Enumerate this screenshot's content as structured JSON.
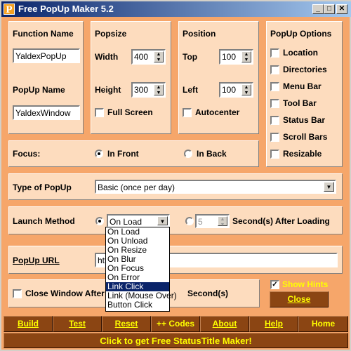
{
  "window": {
    "title": "Free PopUp Maker 5.2",
    "logo": "P",
    "minimize": "_",
    "maximize": "□",
    "close": "✕"
  },
  "function_panel": {
    "function_name_label": "Function Name",
    "function_name_value": "YaldexPopUp",
    "popup_name_label": "PopUp Name",
    "popup_name_value": "YaldexWindow"
  },
  "popsize": {
    "title": "Popsize",
    "width_label": "Width",
    "width_value": "400",
    "height_label": "Height",
    "height_value": "300",
    "full_screen_label": "Full Screen",
    "full_screen_checked": false
  },
  "position": {
    "title": "Position",
    "top_label": "Top",
    "top_value": "100",
    "left_label": "Left",
    "left_value": "100",
    "autocenter_label": "Autocenter",
    "autocenter_checked": false
  },
  "options": {
    "title": "PopUp Options",
    "items": [
      {
        "label": "Location",
        "checked": false
      },
      {
        "label": "Directories",
        "checked": false
      },
      {
        "label": "Menu Bar",
        "checked": false
      },
      {
        "label": "Tool Bar",
        "checked": false
      },
      {
        "label": "Status Bar",
        "checked": false
      },
      {
        "label": "Scroll Bars",
        "checked": false
      },
      {
        "label": "Resizable",
        "checked": false
      }
    ]
  },
  "focus": {
    "label": "Focus:",
    "in_front": "In Front",
    "in_back": "In Back",
    "selected": "In Front"
  },
  "type": {
    "label": "Type of PopUp",
    "value": "Basic (once per day)"
  },
  "launch": {
    "label": "Launch Method",
    "value": "On Load",
    "seconds_value": "5",
    "seconds_label": "Second(s) After Loading",
    "options": [
      "On Load",
      "On Unload",
      "On Resize",
      "On Blur",
      "On Focus",
      "On Error",
      "Link Click",
      "Link (Mouse Over)",
      "Button Click"
    ],
    "highlighted": "Link Click"
  },
  "url": {
    "label": "PopUp URL",
    "value": "htt"
  },
  "close_window": {
    "label": "Close Window After",
    "seconds_label": "Second(s)",
    "checked": false
  },
  "hints": {
    "label": "Show Hints",
    "checked": true
  },
  "close_button": "Close",
  "buttons": [
    "Build",
    "Test",
    "Reset",
    "++ Codes",
    "About",
    "Help",
    "Home"
  ],
  "status_bar": "Click to get   Free StatusTitle Maker!",
  "colors": {
    "background": "#f6a66a",
    "panel": "#fddcbe",
    "button": "#8b4513",
    "button_text": "#ffff00"
  }
}
